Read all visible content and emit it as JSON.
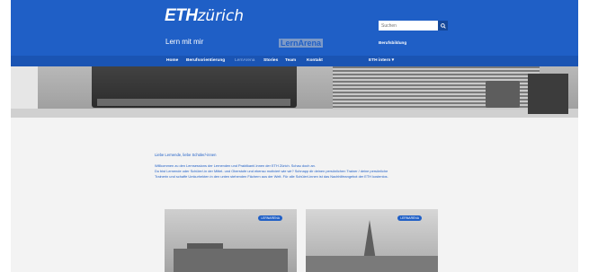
{
  "header": {
    "logo_bold": "ETH",
    "logo_rest": "zürich",
    "subtitle": "Lern mit mir",
    "search_placeholder": "Suchen",
    "berufsbildung": "Berufsbildung"
  },
  "nav": {
    "items": [
      {
        "label": "Home"
      },
      {
        "label": "Berufsorientierung"
      },
      {
        "label": "LernArena"
      },
      {
        "label": "Stories"
      },
      {
        "label": "Team"
      },
      {
        "label": "Kontakt"
      }
    ],
    "eth_intern": "ETH intern ▾"
  },
  "hero": {
    "title": "LernArena"
  },
  "main": {
    "greeting": "Liebe Lernende, liebe Schüler/-innen",
    "intro_lines": [
      "Willkommen zu den Lernsessions der Lernenden und Praktikant/-innen der ETH Zürich. Schau doch an.",
      "Du bist Lernende oder Schüler/-in der Mittel- und Oberstufe und ebenso motiviert wie wir? Schnapp dir deinen persönlichen Trainer / deine persönliche",
      "Trainerin und schaffe Umkurhekten in den unten stehenden Fächern aus der Welt. Für alle Schüler/-innen ist das Nachhilfeangebot der ETH kostenlos."
    ]
  },
  "cards": [
    {
      "badge": "LERNARENA"
    },
    {
      "badge": "LERNARENA"
    }
  ]
}
